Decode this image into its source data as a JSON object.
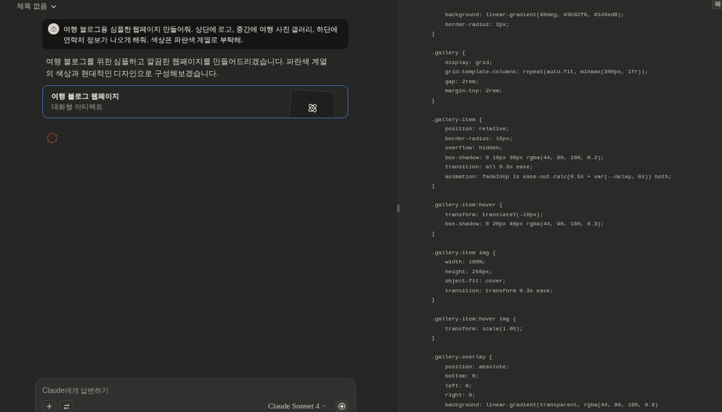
{
  "header": {
    "title": "제목 없음"
  },
  "conversation": [
    {
      "kind": "user",
      "avatar": "소",
      "text": "여행 블로그용 심플한 웹페이지 만들어줘. 상단에 로고, 중간에 여행 사진 갤러리, 하단에 연락처 정보가 나오게 해줘. 색상은 파란색 계열로 부탁해."
    },
    {
      "kind": "assistant",
      "text": "여행 블로그를 위한 심플하고 깔끔한 웹페이지를 만들어드리겠습니다. 파란색 계열의 색상과 현대적인 디자인으로 구성해보겠습니다."
    },
    {
      "kind": "artifact",
      "title": "여행 블로그 웹페이지",
      "subtitle": "대화형 아티팩트",
      "selected": true
    },
    {
      "kind": "loading"
    }
  ],
  "composer": {
    "placeholder": "Claude에게 답변하기",
    "model": "Claude Sonnet 4"
  },
  "code_panel": {
    "copy_button": "복",
    "blocks": [
      [
        "    background: linear-gradient(90deg, #3b82f6, #1d4ed8);",
        "    border-radius: 2px;",
        "}"
      ],
      [
        ".gallery {",
        "    display: grid;",
        "    grid-template-columns: repeat(auto-fit, minmax(300px, 1fr));",
        "    gap: 2rem;",
        "    margin-top: 2rem;",
        "}"
      ],
      [
        ".gallery-item {",
        "    position: relative;",
        "    border-radius: 15px;",
        "    overflow: hidden;",
        "    box-shadow: 0 10px 30px rgba(44, 90, 160, 0.2);",
        "    transition: all 0.3s ease;",
        "    animation: fadeInUp 1s ease-out calc(0.5s + var(--delay, 0s)) both;",
        "}"
      ],
      [
        ".gallery-item:hover {",
        "    transform: translateY(-10px);",
        "    box-shadow: 0 20px 40px rgba(44, 90, 160, 0.3);",
        "}"
      ],
      [
        ".gallery-item img {",
        "    width: 100%;",
        "    height: 250px;",
        "    object-fit: cover;",
        "    transition: transform 0.3s ease;",
        "}"
      ],
      [
        ".gallery-item:hover img {",
        "    transform: scale(1.05);",
        "}"
      ],
      [
        ".gallery-overlay {",
        "    position: absolute;",
        "    bottom: 0;",
        "    left: 0;",
        "    right: 0;",
        "    background: linear-gradient(transparent, rgba(44, 90, 160, 0.9)"
      ]
    ]
  }
}
